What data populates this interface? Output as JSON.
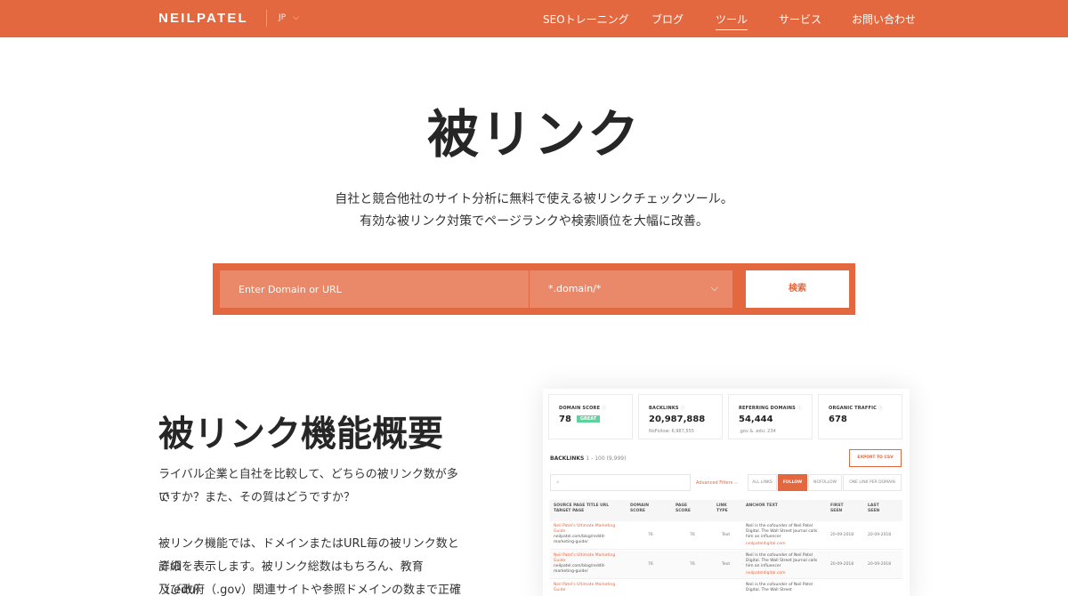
{
  "header": {
    "logo": "NEILPATEL",
    "lang": "JP",
    "nav": [
      "SEOトレーニング",
      "ブログ",
      "ツール",
      "サービス",
      "お問い合わせ"
    ],
    "active_nav": "ツール",
    "brand_color": "#e4683f"
  },
  "hero": {
    "title": "被リンク",
    "subtitle_line1": "自社と競合他社のサイト分析に無料で使える被リンクチェックツール。",
    "subtitle_line2": "有効な被リンク対策でページランクや検索順位を大幅に改善。"
  },
  "search": {
    "placeholder": "Enter Domain or URL",
    "mode_value": "*.domain/*",
    "button_label": "検索"
  },
  "features": {
    "title": "被リンク機能概要",
    "p1_line1": "ライバル企業と自社を比較して、どちらの被リンク数が多い",
    "p1_line2": "ですか？また、その質はどうですか？",
    "p2_line1": "被リンク機能では、ドメインまたはURL毎の被リンク数とその",
    "p2_line2": "詳細を表示します。被リンク総数はもちろん、教育（.edu）",
    "p2_line3": "及び政府（.gov）関連サイトや参照ドメインの数まで正確に"
  },
  "mock": {
    "cards": [
      {
        "label": "DOMAIN SCORE",
        "value": "78",
        "badge": "GREAT",
        "sub": ""
      },
      {
        "label": "BACKLINKS",
        "value": "20,987,888",
        "sub": "NoFollow: 6,987,555"
      },
      {
        "label": "REFERRING DOMAINS",
        "value": "54,444",
        "sub": ".gov & .edu: 234"
      },
      {
        "label": "ORGANIC TRAFFIC",
        "value": "678",
        "sub": ""
      }
    ],
    "backlinks_title": "BACKLINKS",
    "backlinks_range": "1 - 100 (9,999)",
    "export_label": "EXPORT TO CSV",
    "advanced_filters": "Advanced Filters",
    "tabs": [
      "ALL LINKS",
      "FOLLOW",
      "NOFOLLOW",
      "ONE LINK PER DOMAIN"
    ],
    "active_tab": "FOLLOW",
    "columns": [
      "SOURCE PAGE TITLE URL",
      "TARGET PAGE",
      "DOMAIN SCORE",
      "PAGE SCORE",
      "LINK TYPE",
      "ANCHOR TEXT",
      "FIRST SEEN",
      "LAST SEEN"
    ],
    "rows": [
      {
        "title": "Neil Patel's Ultimate Marketing Guide",
        "url": "neilpatel.com/blog/reddit-marketing-guide/",
        "domain_score": "76",
        "page_score": "76",
        "type": "Text",
        "anchor1": "Neil is the cofounder of Neil Patel Digital. The Wall Street Journal calls him an influencer",
        "anchor_link": "neilpateldigital.com",
        "first": "20-09-2018",
        "last": "20-09-2018"
      },
      {
        "title": "Neil Patel's Ultimate Marketing Guide",
        "url": "neilpatel.com/blog/reddit-marketing-guide/",
        "domain_score": "76",
        "page_score": "76",
        "type": "Text",
        "anchor1": "Neil is the cofounder of Neil Patel Digital. The Wall Street Journal calls him an influencer",
        "anchor_link": "neilpateldigital.com",
        "first": "20-09-2018",
        "last": "20-09-2018"
      },
      {
        "title": "Neil Patel's Ultimate Marketing Guide",
        "url": "",
        "domain_score": "",
        "page_score": "",
        "type": "",
        "anchor1": "Neil is the cofounder of Neil Patel Digital. The Wall Street",
        "anchor_link": "",
        "first": "",
        "last": ""
      }
    ]
  }
}
